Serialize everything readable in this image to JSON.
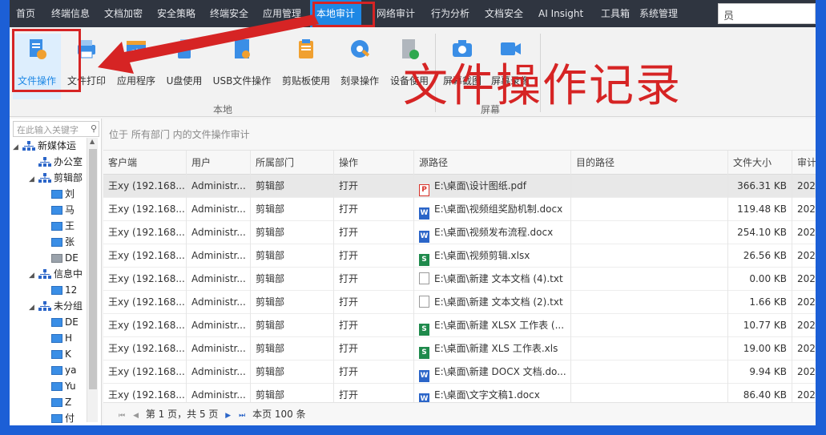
{
  "menu": {
    "items": [
      "首页",
      "终端信息",
      "文档加密",
      "安全策略",
      "终端安全",
      "应用管理",
      "本地审计",
      "网络审计",
      "行为分析",
      "文档安全",
      "AI Insight",
      "工具箱",
      "系统管理"
    ],
    "active": "本地审计",
    "search_text": "员"
  },
  "ribbon": {
    "tools": [
      {
        "label": "文件操作",
        "icon": "file-operation-icon"
      },
      {
        "label": "文件打印",
        "icon": "printer-icon"
      },
      {
        "label": "应用程序",
        "icon": "application-icon"
      },
      {
        "label": "U盘使用",
        "icon": "usb-drive-icon"
      },
      {
        "label": "USB文件操作",
        "icon": "usb-file-icon"
      },
      {
        "label": "剪贴板使用",
        "icon": "clipboard-icon"
      },
      {
        "label": "刻录操作",
        "icon": "disc-burn-icon"
      },
      {
        "label": "设备使用",
        "icon": "device-icon"
      },
      {
        "label": "屏幕截图",
        "icon": "camera-icon"
      },
      {
        "label": "屏幕录像",
        "icon": "video-camera-icon"
      }
    ],
    "group_local": "本地",
    "group_screen": "屏幕"
  },
  "annotation": {
    "text": "文件操作记录",
    "color": "#d62424"
  },
  "sidebar": {
    "search_placeholder": "在此输入关键字",
    "tree": [
      {
        "label": "新媒体运",
        "type": "org",
        "expanded": true
      },
      {
        "label": "办公室",
        "type": "org"
      },
      {
        "label": "剪辑部",
        "type": "org",
        "expanded": true
      },
      {
        "label": "刘",
        "type": "pc"
      },
      {
        "label": "马",
        "type": "pc"
      },
      {
        "label": "王",
        "type": "pc"
      },
      {
        "label": "张",
        "type": "pc"
      },
      {
        "label": "DE",
        "type": "pc-off"
      },
      {
        "label": "信息中",
        "type": "org",
        "expanded": true
      },
      {
        "label": "12",
        "type": "pc"
      },
      {
        "label": "未分组",
        "type": "org",
        "expanded": true
      },
      {
        "label": "DE",
        "type": "pc"
      },
      {
        "label": "H",
        "type": "pc"
      },
      {
        "label": "K",
        "type": "pc"
      },
      {
        "label": "ya",
        "type": "pc"
      },
      {
        "label": "Yu",
        "type": "pc"
      },
      {
        "label": "Z",
        "type": "pc"
      },
      {
        "label": "付",
        "type": "pc"
      }
    ]
  },
  "main": {
    "location": "位于 所有部门 内的文件操作审计",
    "columns": [
      "客户端",
      "用户",
      "所属部门",
      "操作",
      "源路径",
      "目的路径",
      "文件大小",
      "审计"
    ],
    "rows": [
      {
        "client": "王xy (192.168....",
        "user": "Administr...",
        "dept": "剪辑部",
        "op": "打开",
        "type": "pdf",
        "src": "E:\\桌面\\设计图纸.pdf",
        "dst": "",
        "size": "366.31 KB",
        "audit": "202"
      },
      {
        "client": "王xy (192.168....",
        "user": "Administr...",
        "dept": "剪辑部",
        "op": "打开",
        "type": "docx",
        "src": "E:\\桌面\\视频组奖励机制.docx",
        "dst": "",
        "size": "119.48 KB",
        "audit": "202"
      },
      {
        "client": "王xy (192.168....",
        "user": "Administr...",
        "dept": "剪辑部",
        "op": "打开",
        "type": "docx",
        "src": "E:\\桌面\\视频发布流程.docx",
        "dst": "",
        "size": "254.10 KB",
        "audit": "202"
      },
      {
        "client": "王xy (192.168....",
        "user": "Administr...",
        "dept": "剪辑部",
        "op": "打开",
        "type": "xlsx",
        "src": "E:\\桌面\\视频剪辑.xlsx",
        "dst": "",
        "size": "26.56 KB",
        "audit": "202"
      },
      {
        "client": "王xy (192.168....",
        "user": "Administr...",
        "dept": "剪辑部",
        "op": "打开",
        "type": "txt",
        "src": "E:\\桌面\\新建 文本文档 (4).txt",
        "dst": "",
        "size": "0.00 KB",
        "audit": "202"
      },
      {
        "client": "王xy (192.168....",
        "user": "Administr...",
        "dept": "剪辑部",
        "op": "打开",
        "type": "txt",
        "src": "E:\\桌面\\新建 文本文档 (2).txt",
        "dst": "",
        "size": "1.66 KB",
        "audit": "202"
      },
      {
        "client": "王xy (192.168....",
        "user": "Administr...",
        "dept": "剪辑部",
        "op": "打开",
        "type": "xlsx",
        "src": "E:\\桌面\\新建 XLSX 工作表 (...",
        "dst": "",
        "size": "10.77 KB",
        "audit": "202"
      },
      {
        "client": "王xy (192.168....",
        "user": "Administr...",
        "dept": "剪辑部",
        "op": "打开",
        "type": "xlsx",
        "src": "E:\\桌面\\新建 XLS 工作表.xls",
        "dst": "",
        "size": "19.00 KB",
        "audit": "202"
      },
      {
        "client": "王xy (192.168....",
        "user": "Administr...",
        "dept": "剪辑部",
        "op": "打开",
        "type": "docx",
        "src": "E:\\桌面\\新建 DOCX 文档.do...",
        "dst": "",
        "size": "9.94 KB",
        "audit": "202"
      },
      {
        "client": "王xy (192.168....",
        "user": "Administr...",
        "dept": "剪辑部",
        "op": "打开",
        "type": "docx",
        "src": "E:\\桌面\\文字文稿1.docx",
        "dst": "",
        "size": "86.40 KB",
        "audit": "202"
      }
    ],
    "pager": {
      "page_text": "第 1 页，共 5 页",
      "total_text": "本页 100 条"
    }
  }
}
